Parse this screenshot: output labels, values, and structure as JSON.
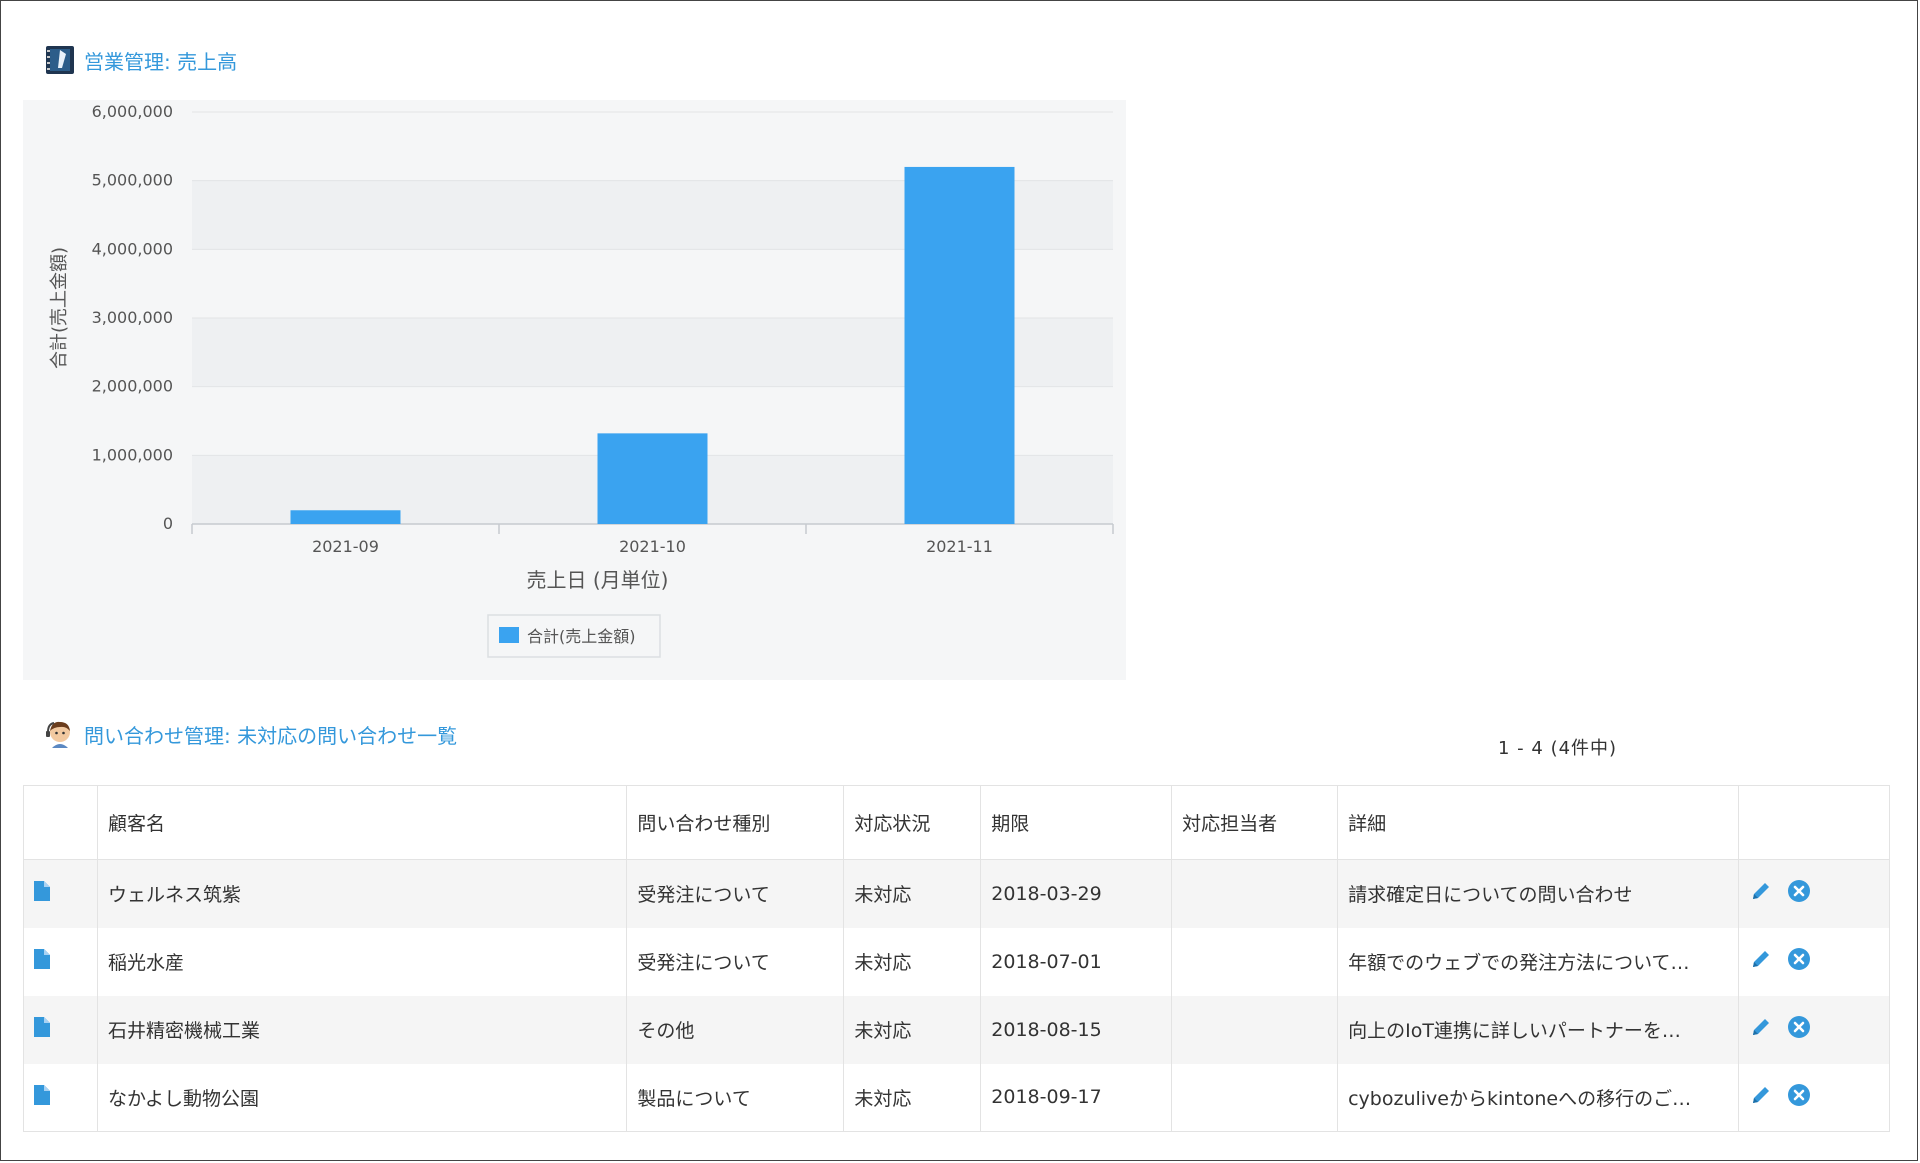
{
  "colors": {
    "accent": "#3498db",
    "bar": "#3aa3f0"
  },
  "sales_section": {
    "title": "営業管理: 売上高",
    "icon": "notebook-app-icon"
  },
  "chart_data": {
    "type": "bar",
    "categories": [
      "2021-09",
      "2021-10",
      "2021-11"
    ],
    "series": [
      {
        "name": "合計(売上金額)",
        "values": [
          200000,
          1320000,
          5200000
        ]
      }
    ],
    "xlabel": "売上日 (月単位)",
    "ylabel": "合計(売上金額)",
    "ylim": [
      0,
      6000000
    ],
    "yticks": [
      "0",
      "1,000,000",
      "2,000,000",
      "3,000,000",
      "4,000,000",
      "5,000,000",
      "6,000,000"
    ],
    "grid": true,
    "legend_position": "bottom-center"
  },
  "inquiry_section": {
    "title": "問い合わせ管理: 未対応の問い合わせ一覧",
    "icon": "support-person-icon",
    "pager": "1 - 4 (4件中)"
  },
  "table": {
    "columns": [
      "",
      "顧客名",
      "問い合わせ種別",
      "対応状況",
      "期限",
      "対応担当者",
      "詳細",
      ""
    ],
    "rows": [
      {
        "customer": "ウェルネス筑紫",
        "type": "受発注について",
        "status": "未対応",
        "due": "2018-03-29",
        "assignee": "",
        "detail": "請求確定日についての問い合わせ"
      },
      {
        "customer": "稲光水産",
        "type": "受発注について",
        "status": "未対応",
        "due": "2018-07-01",
        "assignee": "",
        "detail": "年額でのウェブでの発注方法について…"
      },
      {
        "customer": "石井精密機械工業",
        "type": "その他",
        "status": "未対応",
        "due": "2018-08-15",
        "assignee": "",
        "detail": "向上のIoT連携に詳しいパートナーを…"
      },
      {
        "customer": "なかよし動物公園",
        "type": "製品について",
        "status": "未対応",
        "due": "2018-09-17",
        "assignee": "",
        "detail": "cybozuliveからkintoneへの移行のご…"
      }
    ]
  }
}
